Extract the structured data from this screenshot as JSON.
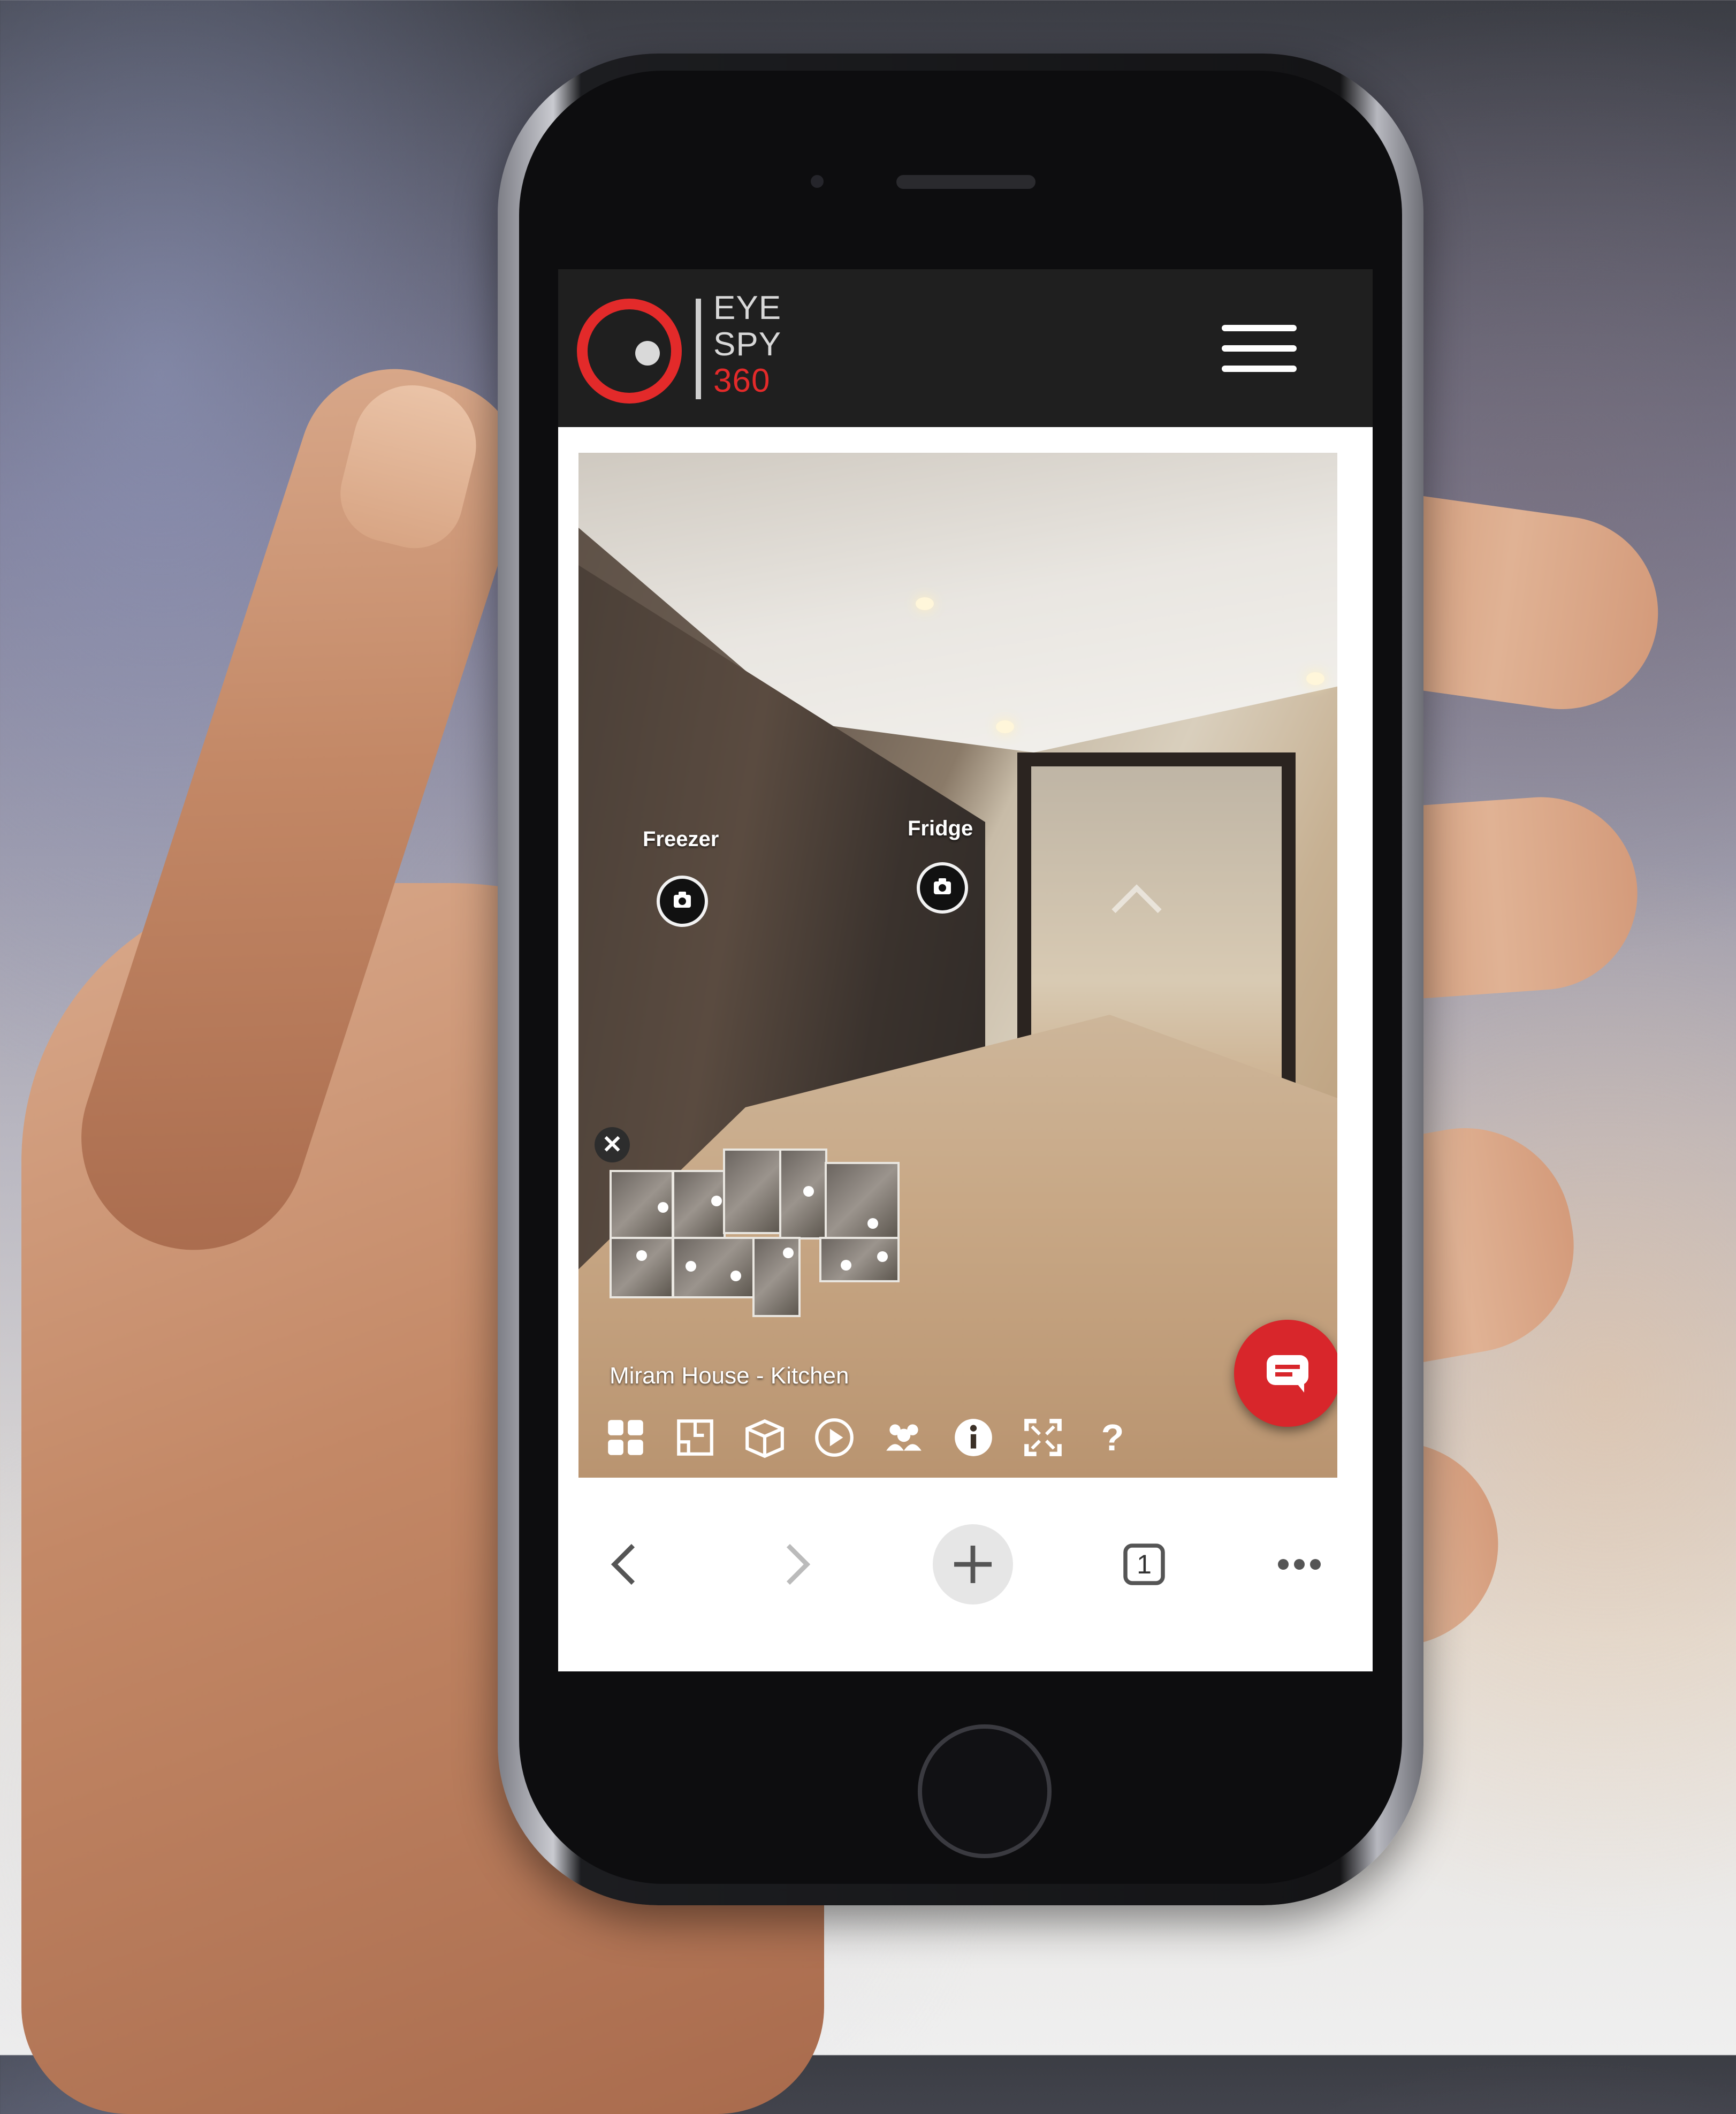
{
  "logo": {
    "line1": "EYE",
    "line2": "SPY",
    "line3": "360"
  },
  "hotspots": [
    {
      "label": "Freezer",
      "icon": "camera-icon"
    },
    {
      "label": "Fridge",
      "icon": "camera-icon"
    }
  ],
  "tour": {
    "title": "Miram House - Kitchen"
  },
  "minimap": {
    "close_label": "✕"
  },
  "toolbar": {
    "help_label": "?",
    "icons": [
      "grid-icon",
      "floorplan-icon",
      "dollhouse-icon",
      "play-icon",
      "people-icon",
      "info-icon",
      "fullscreen-icon",
      "help-icon"
    ]
  },
  "browser": {
    "tab_count": "1"
  },
  "colors": {
    "brand_red": "#e32a2a",
    "header_bg": "#1f1f1f",
    "chat_red": "#d8262b"
  }
}
